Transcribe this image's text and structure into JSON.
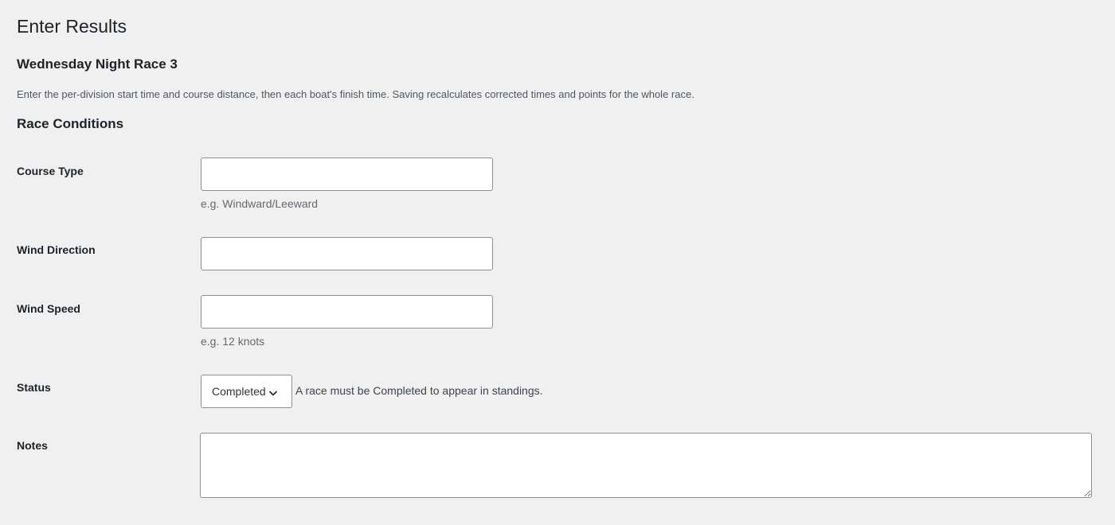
{
  "page": {
    "title": "Enter Results",
    "race_name": "Wednesday Night Race 3",
    "description": "Enter the per-division start time and course distance, then each boat's finish time. Saving recalculates corrected times and points for the whole race."
  },
  "race_conditions": {
    "heading": "Race Conditions",
    "course_type": {
      "label": "Course Type",
      "value": "",
      "hint": "e.g. Windward/Leeward"
    },
    "wind_direction": {
      "label": "Wind Direction",
      "value": ""
    },
    "wind_speed": {
      "label": "Wind Speed",
      "value": "",
      "hint": "e.g. 12 knots"
    },
    "status": {
      "label": "Status",
      "selected": "Completed",
      "note": "A race must be Completed to appear in standings."
    },
    "notes": {
      "label": "Notes",
      "value": ""
    }
  },
  "colors": {
    "background": "#f0f0f1",
    "text": "#1d2327",
    "muted_text": "#646970",
    "input_border": "#8c8f94"
  }
}
